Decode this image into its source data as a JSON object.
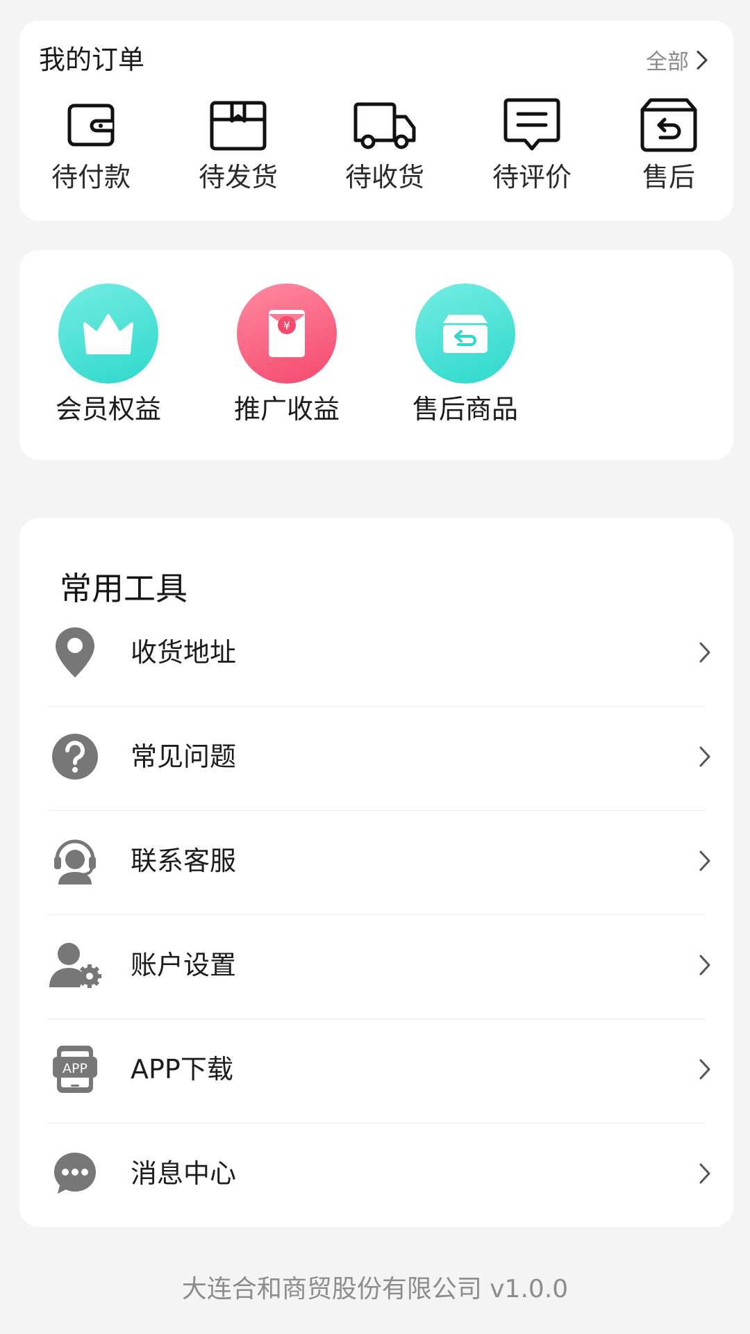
{
  "orders": {
    "title": "我的订单",
    "all_label": "全部",
    "items": [
      {
        "label": "待付款",
        "icon": "wallet-icon"
      },
      {
        "label": "待发货",
        "icon": "package-icon"
      },
      {
        "label": "待收货",
        "icon": "delivery-truck-icon"
      },
      {
        "label": "待评价",
        "icon": "review-message-icon"
      },
      {
        "label": "售后",
        "icon": "return-box-icon"
      }
    ]
  },
  "benefits": {
    "items": [
      {
        "label": "会员权益",
        "icon": "crown-icon",
        "color": "#2ed8cc"
      },
      {
        "label": "推广收益",
        "icon": "red-envelope-icon",
        "color": "#f5486d"
      },
      {
        "label": "售后商品",
        "icon": "return-box-icon",
        "color": "#2ed8cc"
      }
    ]
  },
  "tools": {
    "title": "常用工具",
    "items": [
      {
        "label": "收货地址",
        "icon": "location-pin-icon"
      },
      {
        "label": "常见问题",
        "icon": "question-icon"
      },
      {
        "label": "联系客服",
        "icon": "customer-service-icon"
      },
      {
        "label": "账户设置",
        "icon": "user-settings-icon"
      },
      {
        "label": "APP下载",
        "icon": "app-download-icon"
      },
      {
        "label": "消息中心",
        "icon": "message-icon"
      }
    ]
  },
  "footer": {
    "text": "大连合和商贸股份有限公司 v1.0.0"
  }
}
